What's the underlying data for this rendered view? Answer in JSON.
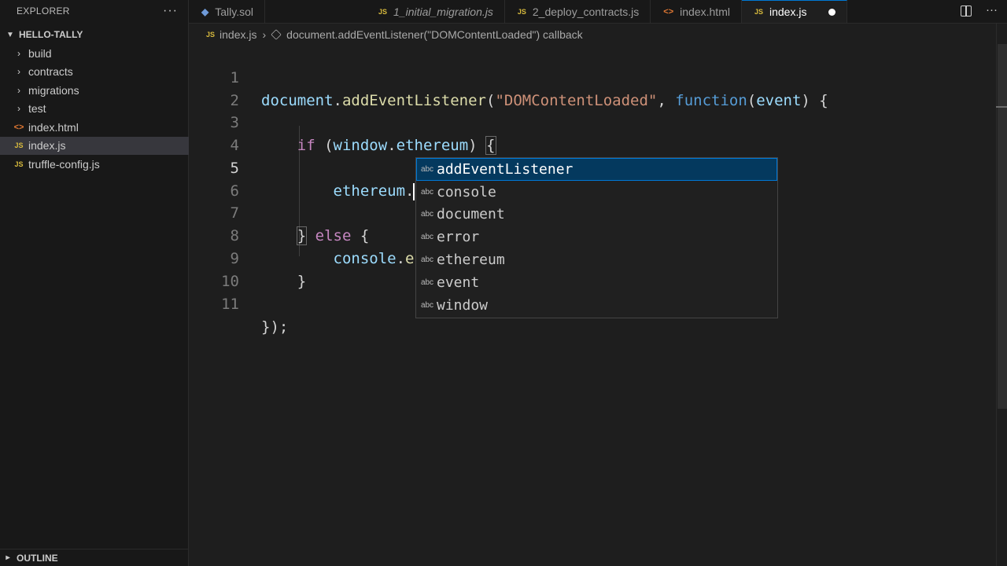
{
  "sidebar": {
    "title": "EXPLORER",
    "more": "···",
    "folder": "HELLO-TALLY",
    "items": [
      {
        "label": "build",
        "icon": "chevron-right-icon",
        "type": "folder"
      },
      {
        "label": "contracts",
        "icon": "chevron-right-icon",
        "type": "folder"
      },
      {
        "label": "migrations",
        "icon": "chevron-right-icon",
        "type": "folder"
      },
      {
        "label": "test",
        "icon": "chevron-right-icon",
        "type": "folder"
      },
      {
        "label": "index.html",
        "icon": "html-file-icon",
        "type": "html"
      },
      {
        "label": "index.js",
        "icon": "js-file-icon",
        "type": "js",
        "active": true
      },
      {
        "label": "truffle-config.js",
        "icon": "js-file-icon",
        "type": "js"
      }
    ],
    "outline": "OUTLINE"
  },
  "tabs": [
    {
      "label": "Tally.sol",
      "icon": "solidity-file-icon"
    },
    {
      "label": "1_initial_migration.js",
      "icon": "js-file-icon"
    },
    {
      "label": "2_deploy_contracts.js",
      "icon": "js-file-icon"
    },
    {
      "label": "index.html",
      "icon": "html-file-icon"
    },
    {
      "label": "index.js",
      "icon": "js-file-icon",
      "active": true,
      "dirty": true
    }
  ],
  "breadcrumb": {
    "file": "index.js",
    "symbol": "document.addEventListener(\"DOMContentLoaded\") callback"
  },
  "icon_labels": {
    "js": "JS",
    "html": "<>",
    "chevron": "›",
    "abc": "abc"
  },
  "editor": {
    "line_numbers": [
      "1",
      "2",
      "3",
      "4",
      "5",
      "6",
      "7",
      "8",
      "9",
      "10",
      "11"
    ],
    "current_line": "5"
  },
  "suggestions": [
    {
      "label": "addEventListener",
      "kind": "abc",
      "selected": true
    },
    {
      "label": "console",
      "kind": "abc"
    },
    {
      "label": "document",
      "kind": "abc"
    },
    {
      "label": "error",
      "kind": "abc"
    },
    {
      "label": "ethereum",
      "kind": "abc"
    },
    {
      "label": "event",
      "kind": "abc"
    },
    {
      "label": "window",
      "kind": "abc"
    }
  ],
  "colors": {
    "background": "#1e1e1e",
    "sidebar": "#181818",
    "accent": "#0078d4",
    "keyword_control": "#c586c0",
    "function": "#dcdcaa",
    "variable": "#9cdcfe",
    "string": "#ce9178"
  }
}
